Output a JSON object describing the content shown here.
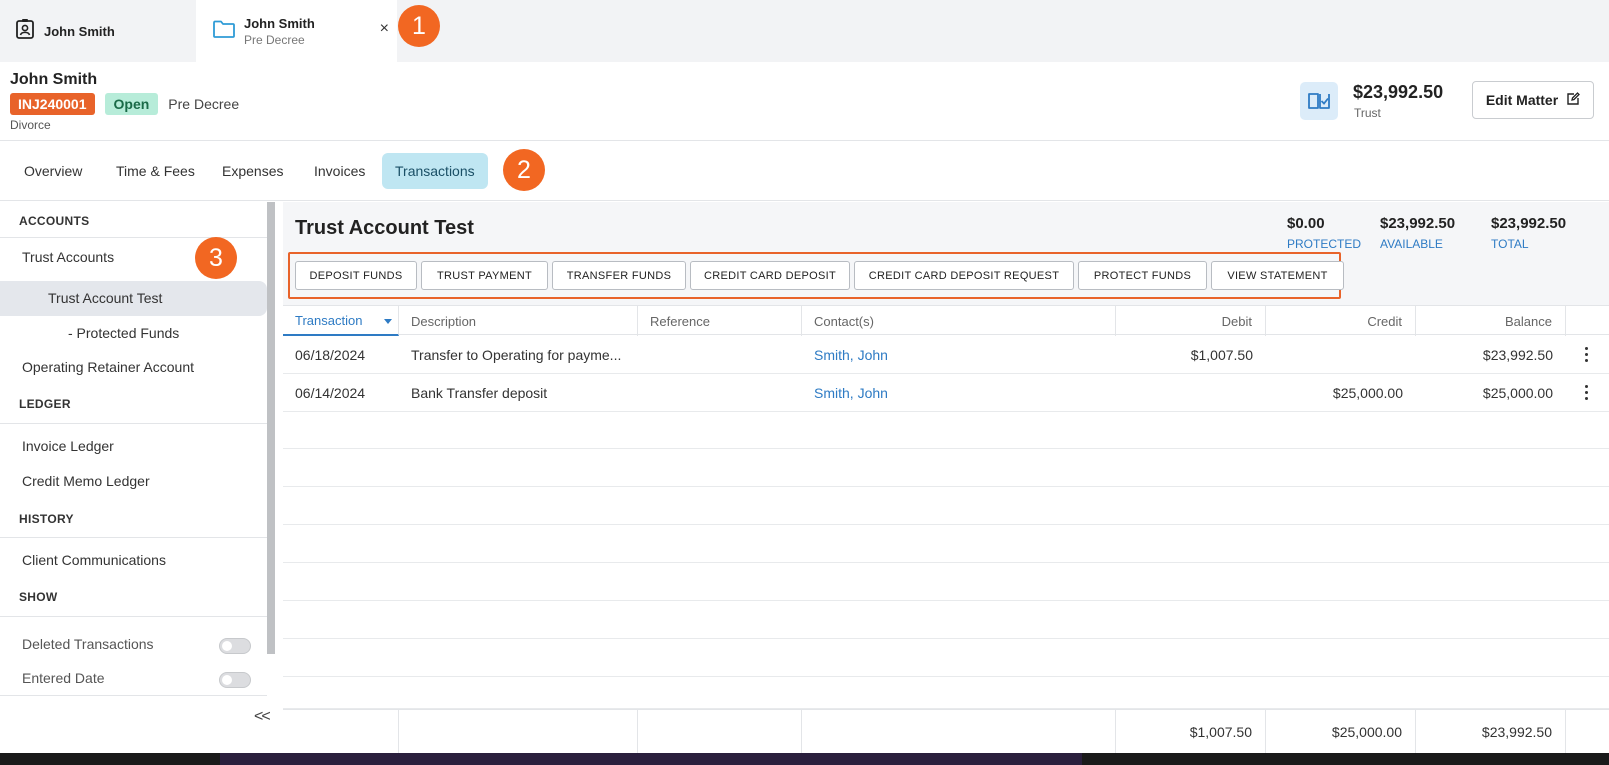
{
  "tabs": [
    {
      "title": "John Smith"
    },
    {
      "title": "John Smith",
      "subtitle": "Pre Decree",
      "close": "×"
    }
  ],
  "callouts": [
    "1",
    "2",
    "3"
  ],
  "matter": {
    "name": "John Smith",
    "id": "INJ240001",
    "status": "Open",
    "stage": "Pre Decree",
    "type": "Divorce",
    "trust_amount": "$23,992.50",
    "trust_label": "Trust",
    "edit_label": "Edit Matter"
  },
  "nav": {
    "items": [
      "Overview",
      "Time & Fees",
      "Expenses",
      "Invoices",
      "Transactions"
    ],
    "active": "Transactions"
  },
  "sidebar": {
    "accounts_heading": "ACCOUNTS",
    "trust_accounts": "Trust Accounts",
    "trust_account_test": "Trust Account Test",
    "protected_funds": "- Protected Funds",
    "operating_retainer": "Operating Retainer Account",
    "ledger_heading": "LEDGER",
    "invoice_ledger": "Invoice Ledger",
    "credit_memo_ledger": "Credit Memo Ledger",
    "history_heading": "HISTORY",
    "client_comms": "Client Communications",
    "show_heading": "SHOW",
    "deleted_transactions": "Deleted Transactions",
    "entered_date": "Entered Date",
    "collapse": "<<"
  },
  "account": {
    "title": "Trust Account Test",
    "protected_value": "$0.00",
    "protected_label": "PROTECTED",
    "available_value": "$23,992.50",
    "available_label": "AVAILABLE",
    "total_value": "$23,992.50",
    "total_label": "TOTAL"
  },
  "actions": [
    "DEPOSIT FUNDS",
    "TRUST PAYMENT",
    "TRANSFER FUNDS",
    "CREDIT CARD DEPOSIT",
    "CREDIT CARD DEPOSIT REQUEST",
    "PROTECT FUNDS",
    "VIEW STATEMENT"
  ],
  "grid": {
    "columns": [
      "Transaction",
      "Description",
      "Reference",
      "Contact(s)",
      "Debit",
      "Credit",
      "Balance"
    ],
    "rows": [
      {
        "transaction": "06/18/2024",
        "description": "Transfer to Operating for payme...",
        "reference": "",
        "contact": "Smith, John",
        "debit": "$1,007.50",
        "credit": "",
        "balance": "$23,992.50"
      },
      {
        "transaction": "06/14/2024",
        "description": "Bank Transfer deposit",
        "reference": "",
        "contact": "Smith, John",
        "debit": "",
        "credit": "$25,000.00",
        "balance": "$25,000.00"
      }
    ],
    "totals": {
      "debit": "$1,007.50",
      "credit": "$25,000.00",
      "balance": "$23,992.50"
    }
  },
  "colors": {
    "accent_orange": "#e8632a",
    "link_blue": "#2e7bc4",
    "active_tab_bg": "#bfe6f2",
    "open_badge_bg": "#b7ecd9"
  }
}
